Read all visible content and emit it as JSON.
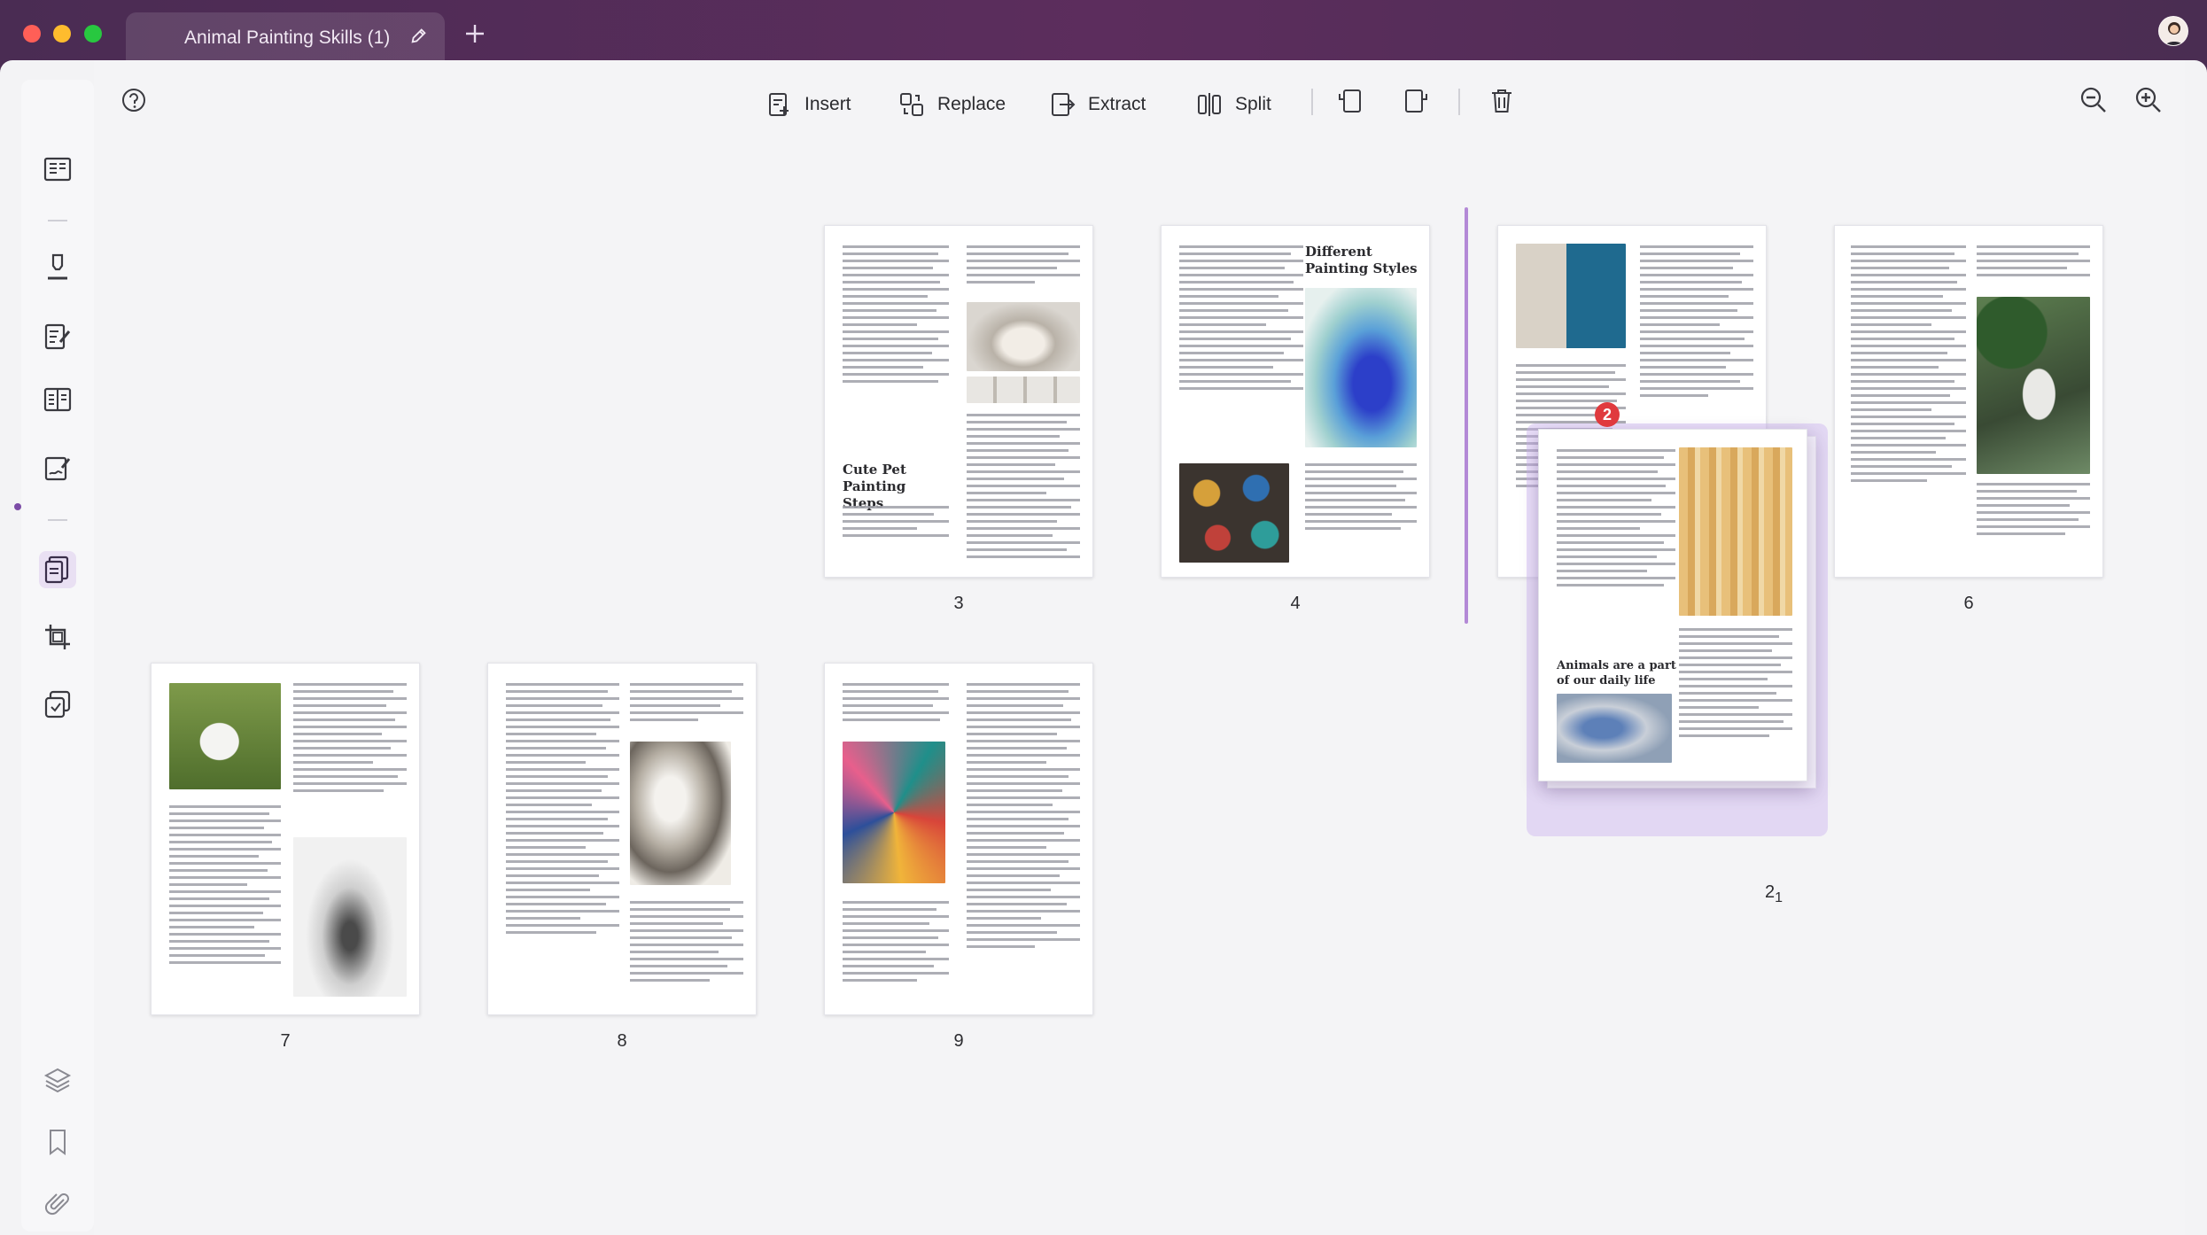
{
  "window": {
    "tab_title": "Animal Painting Skills (1)",
    "tab_edit_icon": "pencil-icon",
    "new_tab_icon": "plus-icon"
  },
  "toolbar": {
    "insert_label": "Insert",
    "replace_label": "Replace",
    "extract_label": "Extract",
    "split_label": "Split"
  },
  "sidebar": {
    "items": [
      "reader-icon",
      "highlighter-icon",
      "edit-pdf-icon",
      "form-icon",
      "sign-icon",
      "organize-pages-icon",
      "crop-icon",
      "batch-icon",
      "layers-icon",
      "bookmark-icon",
      "attachment-icon"
    ]
  },
  "pages": [
    {
      "num": "3",
      "heading": "Cute Pet Painting Steps"
    },
    {
      "num": "4",
      "heading": "Different Painting Styles"
    },
    {
      "num": "",
      "heading": ""
    },
    {
      "num": "6",
      "heading": ""
    },
    {
      "num": "7",
      "heading": ""
    },
    {
      "num": "8",
      "heading": ""
    },
    {
      "num": "9",
      "heading": ""
    }
  ],
  "drag": {
    "count": "2",
    "label_main": "2",
    "label_sub": "1",
    "page_heading": "Animals are a part of our daily life"
  },
  "colors": {
    "accent": "#7b4ba6",
    "badge": "#e03a3e",
    "insert_line": "#b389d6"
  }
}
